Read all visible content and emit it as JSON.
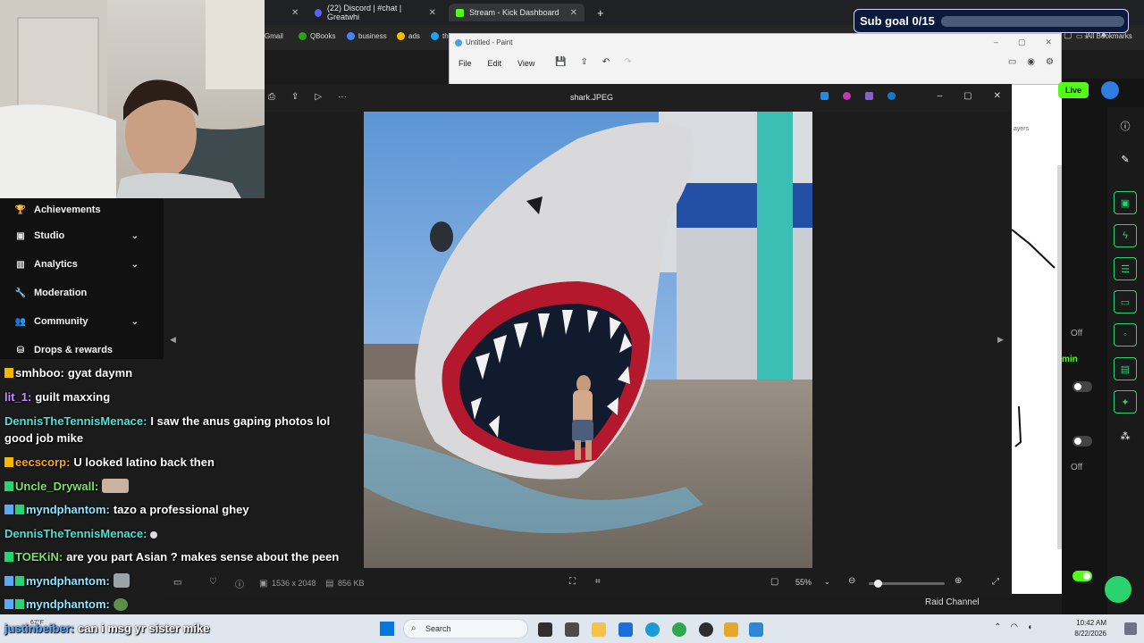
{
  "browser": {
    "tabs": [
      {
        "label": "(22) Discord | #chat | Greatwhi"
      },
      {
        "label": "Stream - Kick Dashboard"
      }
    ],
    "bookmarks": [
      "Gmail",
      "QBooks",
      "business",
      "ads",
      "th"
    ],
    "all_bookmarks": "All Bookmarks"
  },
  "sub_goal": {
    "label": "Sub goal 0/15",
    "progress": 0
  },
  "paint": {
    "title": "Untitled - Paint",
    "menu": [
      "File",
      "Edit",
      "View"
    ]
  },
  "sidebar": {
    "items": [
      {
        "label": "Achievements",
        "icon": "trophy-icon",
        "has_chevron": false
      },
      {
        "label": "Studio",
        "icon": "studio-icon",
        "has_chevron": true
      },
      {
        "label": "Analytics",
        "icon": "analytics-icon",
        "has_chevron": true
      },
      {
        "label": "Moderation",
        "icon": "wrench-icon",
        "has_chevron": false
      },
      {
        "label": "Community",
        "icon": "community-icon",
        "has_chevron": true
      },
      {
        "label": "Drops & rewards",
        "icon": "drops-icon",
        "has_chevron": false
      }
    ]
  },
  "chat": [
    {
      "user": "smhboo:",
      "text": "gyat daymn",
      "color": "#ffffff"
    },
    {
      "user": "lit_1:",
      "text": "guilt maxxing",
      "color": "#c58cff"
    },
    {
      "user": "DennisTheTennisMenace:",
      "text": "I saw the anus gaping photos lol",
      "color": "#53e0d3"
    },
    {
      "user": "",
      "text": "good job mike",
      "color": "#ffffff"
    },
    {
      "user": "eecscorp:",
      "text": "U looked latino back then",
      "color": "#f5a623"
    },
    {
      "user": "Uncle_Drywall:",
      "text": "",
      "color": "#7ee06b"
    },
    {
      "user": "myndphantom:",
      "text": "tazo a professional ghey",
      "color": "#8ee6ff"
    },
    {
      "user": "DennisTheTennisMenace:",
      "text": "",
      "color": "#53e0d3"
    },
    {
      "user": "TOEKiN:",
      "text": "are you part Asian ? makes sense about the peen",
      "color": "#7ee06b"
    },
    {
      "user": "myndphantom:",
      "text": "",
      "color": "#8ee6ff"
    },
    {
      "user": "myndphantom:",
      "text": "",
      "color": "#8ee6ff"
    },
    {
      "user": "justinbeiber:",
      "text": "can i msg yr sister mike",
      "color": "#5aa8ff"
    }
  ],
  "viewer": {
    "filename": "shark.JPEG",
    "dimensions": "1536 x 2048",
    "filesize": "856 KB",
    "zoom": "55%"
  },
  "dashboard": {
    "toggle_labels": [
      "Off",
      "min",
      "Off"
    ],
    "raid_channel": "Raid Channel",
    "go_live": "Live",
    "layers": "ayers"
  },
  "taskbar": {
    "search_placeholder": "Search",
    "weather": "67°F",
    "time": "10:42 AM",
    "date": "8/22/2026"
  },
  "colors": {
    "accent": "#2ad36f",
    "kick_green": "#53fc18"
  }
}
